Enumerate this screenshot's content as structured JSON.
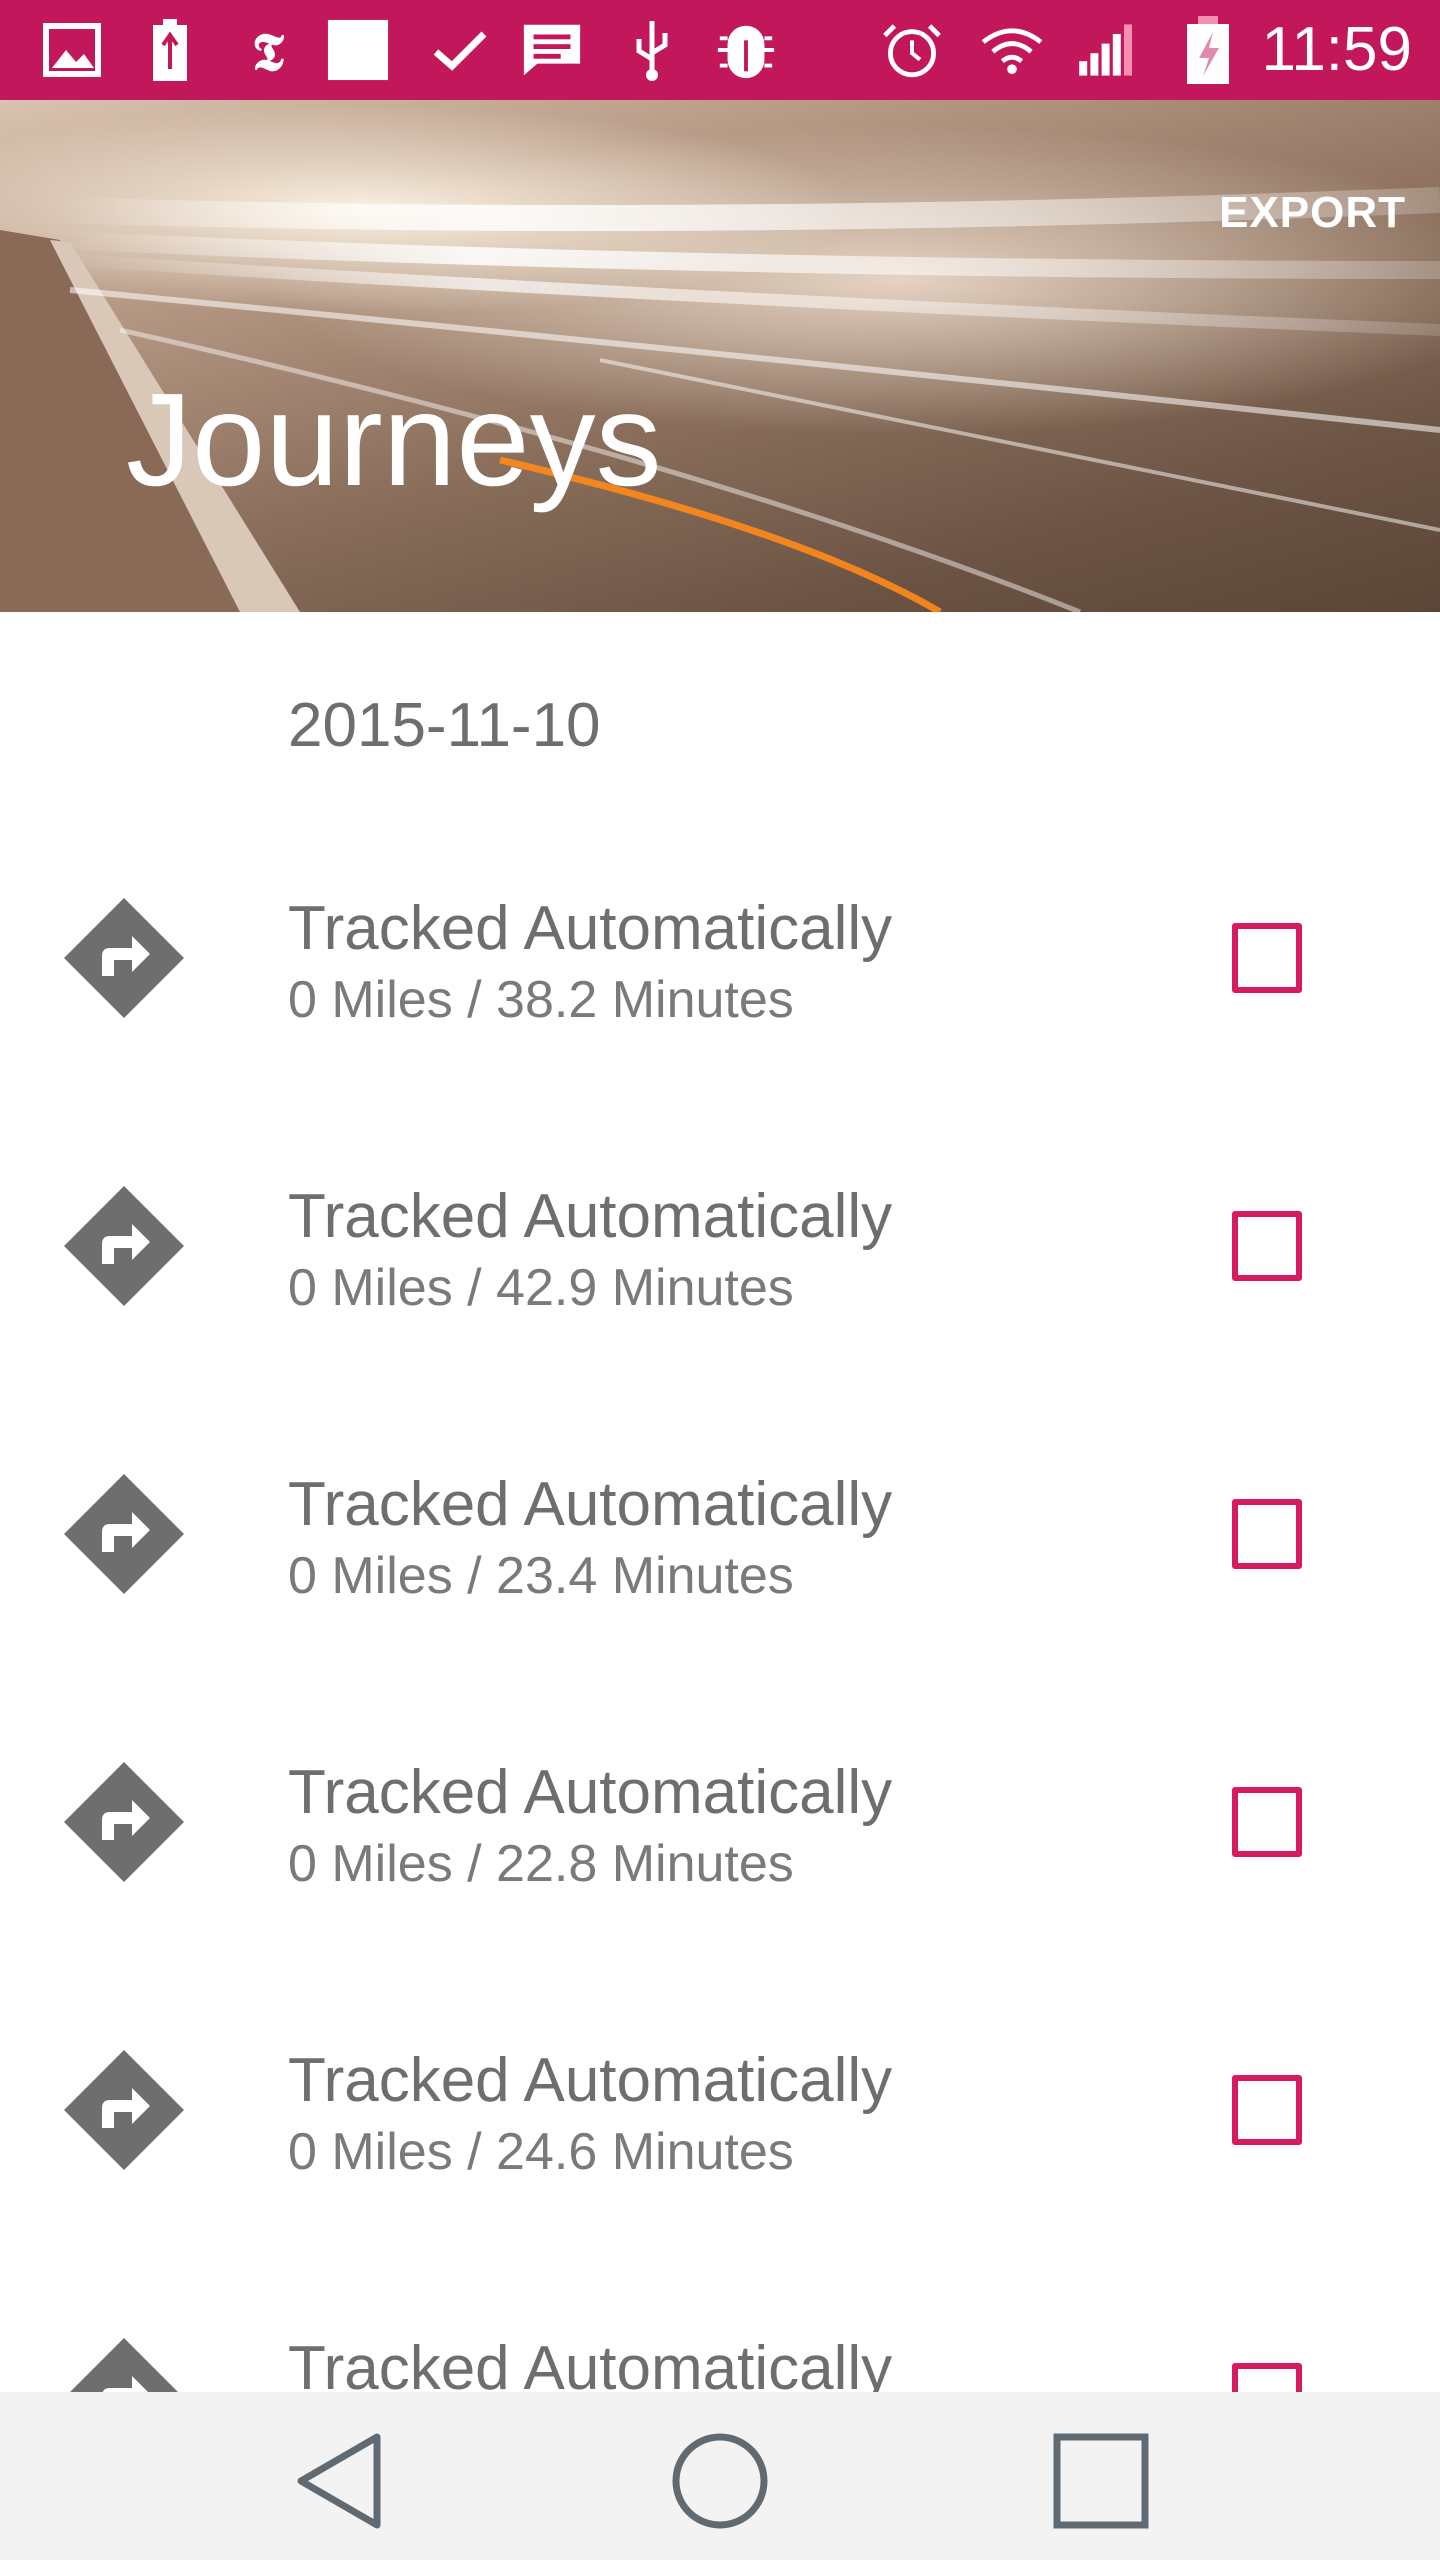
{
  "status_bar": {
    "time": "11:59",
    "icons": [
      "image-icon",
      "usb-battery-icon",
      "nyt-icon",
      "square-icon",
      "check-icon",
      "message-icon",
      "usb-icon",
      "bug-icon",
      "alarm-icon",
      "wifi-icon",
      "signal-icon",
      "battery-charging-icon"
    ],
    "background": "#c2185b"
  },
  "header": {
    "action_label": "EXPORT",
    "title": "Journeys"
  },
  "list": {
    "date": "2015-11-10",
    "items": [
      {
        "title": "Tracked Automatically",
        "subtitle": "0 Miles / 38.2 Minutes"
      },
      {
        "title": "Tracked Automatically",
        "subtitle": "0 Miles / 42.9 Minutes"
      },
      {
        "title": "Tracked Automatically",
        "subtitle": "0 Miles / 23.4 Minutes"
      },
      {
        "title": "Tracked Automatically",
        "subtitle": "0 Miles / 22.8 Minutes"
      },
      {
        "title": "Tracked Automatically",
        "subtitle": "0 Miles / 24.6 Minutes"
      },
      {
        "title": "Tracked Automatically",
        "subtitle": ""
      }
    ]
  },
  "nav_bar": {
    "icons": [
      "back-icon",
      "home-icon",
      "recents-icon"
    ]
  },
  "colors": {
    "accent": "#d81b60",
    "icon_gray": "#6e6e6e",
    "text_gray": "#6e6e6e"
  }
}
